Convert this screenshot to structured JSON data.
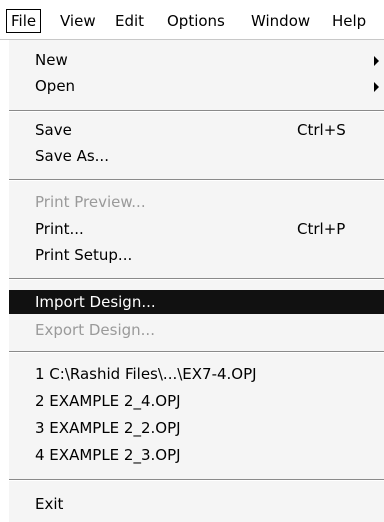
{
  "menubar": {
    "items": [
      "File",
      "View",
      "Edit",
      "Options",
      "Window",
      "Help"
    ],
    "active_index": 0
  },
  "file_menu": {
    "new": "New",
    "open": "Open",
    "save": "Save",
    "save_shortcut": "Ctrl+S",
    "save_as": "Save As...",
    "print_preview": "Print Preview...",
    "print": "Print...",
    "print_shortcut": "Ctrl+P",
    "print_setup": "Print Setup...",
    "import_design": "Import Design...",
    "export_design": "Export Design...",
    "recent_files": [
      "1 C:\\Rashid Files\\...\\EX7-4.OPJ",
      "2 EXAMPLE 2_4.OPJ",
      "3 EXAMPLE 2_2.OPJ",
      "4 EXAMPLE 2_3.OPJ"
    ],
    "exit": "Exit"
  },
  "colors": {
    "highlight": "#111111",
    "menu_background": "#f5f5f5",
    "disabled_text": "#9a9a9a"
  }
}
